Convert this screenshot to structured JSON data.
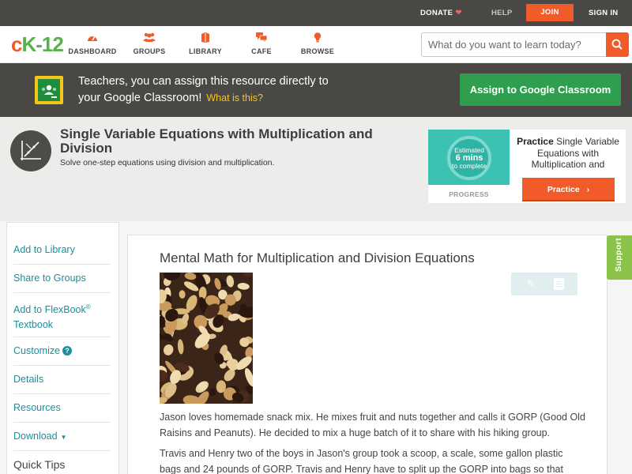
{
  "topbar": {
    "donate": "DONATE",
    "help": "HELP",
    "join": "JOIN",
    "signin": "SIGN IN"
  },
  "logo": {
    "c": "c",
    "k": "K-12"
  },
  "nav": [
    {
      "label": "DASHBOARD",
      "icon": "gauge-icon"
    },
    {
      "label": "GROUPS",
      "icon": "groups-icon"
    },
    {
      "label": "LIBRARY",
      "icon": "library-icon"
    },
    {
      "label": "CAFE",
      "icon": "chat-bubbles-icon"
    },
    {
      "label": "BROWSE",
      "icon": "lightbulb-icon"
    }
  ],
  "search": {
    "placeholder": "What do you want to learn today?"
  },
  "banner": {
    "line1": "Teachers, you can assign this resource directly to",
    "line2": "your Google Classroom!",
    "what_is_this": "What is this?",
    "assign_button": "Assign to Google Classroom"
  },
  "concept": {
    "title": "Single Variable Equations with Multiplication and Division",
    "subtitle": "Solve one-step equations using division and multiplication."
  },
  "practice": {
    "estimated": "Estimated",
    "mins": "6 mins",
    "to_complete": "to complete",
    "progress_label": "PROGRESS",
    "strong": "Practice",
    "desc": "Single Variable Equations with Multiplication and",
    "button": "Practice"
  },
  "sidebar": {
    "items": [
      {
        "label": "Add to Library"
      },
      {
        "label": "Share to Groups"
      },
      {
        "label_line1": "Add to FlexBook",
        "sup": "®",
        "label_line2": "Textbook"
      },
      {
        "label": "Customize",
        "badge": "?"
      },
      {
        "label": "Details"
      },
      {
        "label": "Resources"
      },
      {
        "label": "Download",
        "caret": "▼"
      }
    ],
    "quick_tips": "Quick Tips"
  },
  "article": {
    "title": "Mental Math for Multiplication and Division Equations",
    "image_alt": "snack-mix-photo",
    "para1": "Jason loves homemade snack mix. He mixes fruit and nuts together and calls it GORP (Good Old Raisins and Peanuts). He decided to mix a huge batch of it to share with his hiking group.",
    "para2": "Travis and Henry two of the boys in Jason's group took a scoop, a scale, some gallon plastic bags and 24 pounds of GORP. Travis and Henry have to split up the GORP into bags so that"
  },
  "support": "Support",
  "colors": {
    "accent": "#f15a29",
    "brand_green": "#56b24b",
    "link_teal": "#1a8f9a",
    "dark_bar": "#4a4844",
    "classroom_green": "#2f9e4f"
  }
}
